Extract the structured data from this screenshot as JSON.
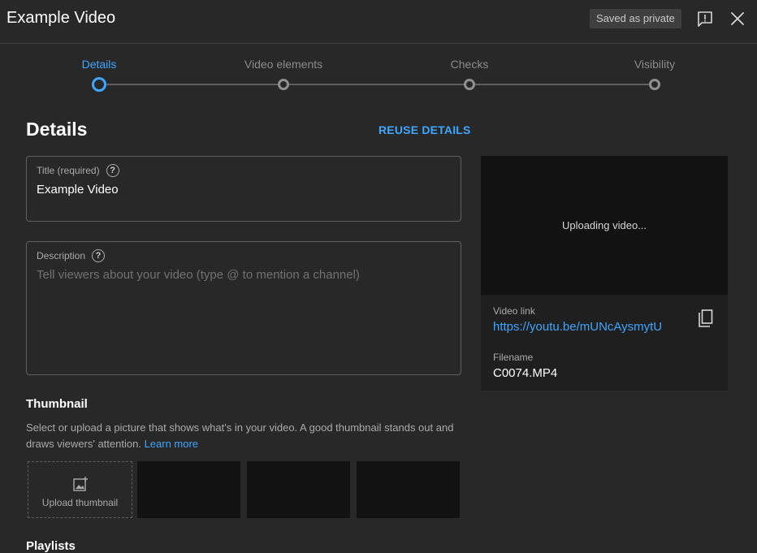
{
  "header": {
    "title": "Example Video",
    "saved_status": "Saved as private",
    "feedback_icon": "feedback-icon",
    "close_icon": "close-icon"
  },
  "stepper": {
    "steps": [
      {
        "label": "Details",
        "active": true
      },
      {
        "label": "Video elements",
        "active": false
      },
      {
        "label": "Checks",
        "active": false
      },
      {
        "label": "Visibility",
        "active": false
      }
    ]
  },
  "details": {
    "heading": "Details",
    "reuse_label": "REUSE DETAILS",
    "title_field": {
      "label": "Title (required)",
      "value": "Example Video",
      "help": "?"
    },
    "description_field": {
      "label": "Description",
      "placeholder": "Tell viewers about your video (type @ to mention a channel)",
      "value": "",
      "help": "?"
    }
  },
  "preview": {
    "status": "Uploading video...",
    "video_link_label": "Video link",
    "video_link": "https://youtu.be/mUNcAysmytU",
    "filename_label": "Filename",
    "filename": "C0074.MP4",
    "copy_icon": "copy-icon"
  },
  "thumbnail": {
    "heading": "Thumbnail",
    "description": "Select or upload a picture that shows what's in your video. A good thumbnail stands out and draws viewers' attention.",
    "learn_more": "Learn more",
    "upload_label": "Upload thumbnail"
  },
  "playlists": {
    "heading": "Playlists"
  },
  "colors": {
    "background": "#282828",
    "accent": "#3ea6ff",
    "panel": "#1f1f1f",
    "video_bg": "#121212"
  }
}
